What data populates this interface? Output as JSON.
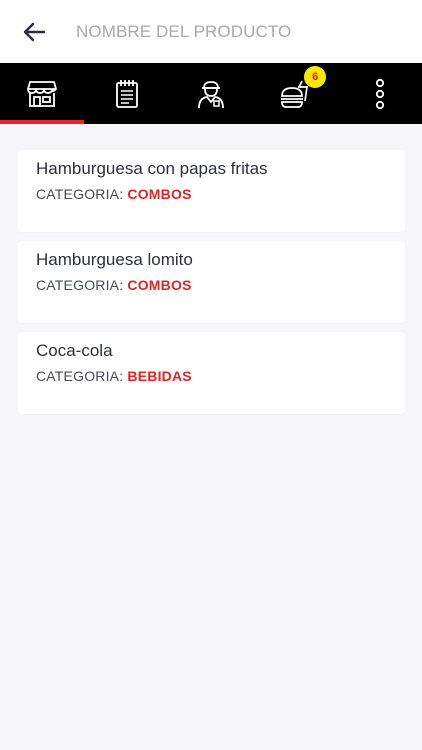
{
  "header": {
    "search_placeholder": "NOMBRE DEL PRODUCTO"
  },
  "tabs": [
    {
      "icon": "store-icon",
      "active": true
    },
    {
      "icon": "notepad-icon",
      "active": false
    },
    {
      "icon": "delivery-person-icon",
      "active": false
    },
    {
      "icon": "burger-drink-icon",
      "active": false,
      "badge": "6"
    },
    {
      "icon": "more-vertical-icon",
      "active": false
    }
  ],
  "colors": {
    "accent": "#e8262a",
    "badge_bg": "#ffe800",
    "category_value": "#e02424",
    "tabbar_bg": "#000000"
  },
  "products": [
    {
      "name": "Hamburguesa con papas fritas",
      "category_label": "CATEGORIA: ",
      "category": "COMBOS"
    },
    {
      "name": "Hamburguesa lomito",
      "category_label": "CATEGORIA: ",
      "category": "COMBOS"
    },
    {
      "name": "Coca-cola",
      "category_label": "CATEGORIA: ",
      "category": "BEBIDAS"
    }
  ]
}
